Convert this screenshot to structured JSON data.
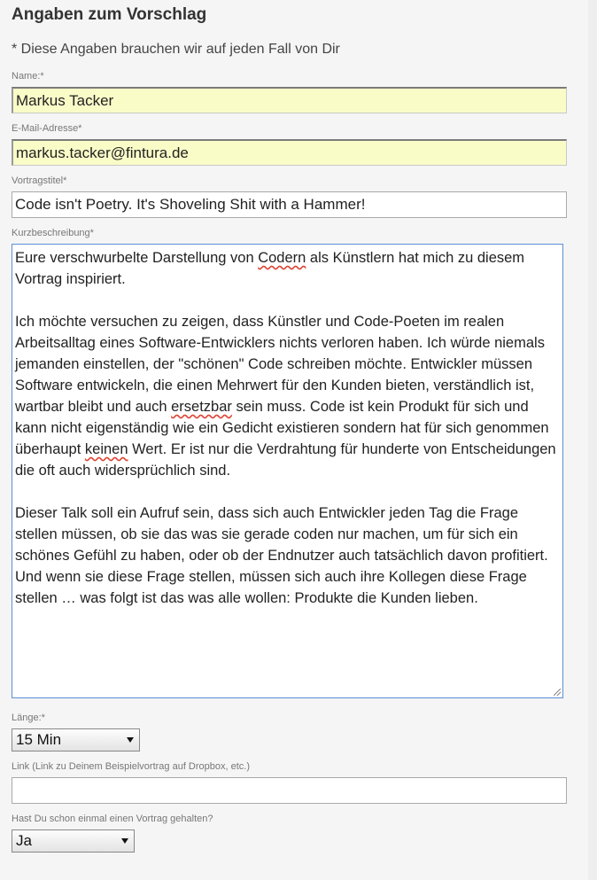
{
  "section": {
    "title": "Angaben zum Vorschlag",
    "required_note": "* Diese Angaben brauchen wir auf jeden Fall von Dir"
  },
  "fields": {
    "name": {
      "label": "Name:*",
      "value": "Markus Tacker"
    },
    "email": {
      "label": "E-Mail-Adresse*",
      "value": "markus.tacker@fintura.de"
    },
    "talk_title": {
      "label": "Vortragstitel*",
      "value": "Code isn't Poetry. It's Shoveling Shit with a Hammer!"
    },
    "summary": {
      "label": "Kurzbeschreibung*",
      "p1a": "Eure verschwurbelte Darstellung von ",
      "p1_misspelled": "Codern",
      "p1b": " als Künstlern hat mich zu diesem Vortrag inspiriert.",
      "p2a": "Ich möchte versuchen zu zeigen, dass Künstler und Code-Poeten im realen Arbeitsalltag eines Software-Entwicklers nichts verloren haben. Ich würde niemals jemanden einstellen, der \"schönen\" Code schreiben möchte. Entwickler müssen Software entwickeln, die einen Mehrwert für den Kunden bieten, verständlich ist, wartbar bleibt und auch ",
      "p2_misspelled1": "ersetzbar",
      "p2b": " sein muss. Code ist kein Produkt für sich und kann nicht eigenständig wie ein Gedicht existieren sondern hat für sich genommen überhaupt ",
      "p2_misspelled2": "keinen",
      "p2c": " Wert. Er ist nur die Verdrahtung für hunderte von Entscheidungen die oft auch widersprüchlich sind.",
      "p3": "Dieser Talk soll ein Aufruf sein, dass sich auch Entwickler jeden Tag die Frage stellen müssen, ob sie das was sie gerade coden nur machen, um für sich ein schönes Gefühl zu haben, oder ob der Endnutzer auch tatsächlich davon profitiert. Und wenn sie diese Frage stellen, müssen sich auch ihre Kollegen diese Frage stellen … was folgt ist das was alle wollen: Produkte die Kunden lieben."
    },
    "length": {
      "label": "Länge:*",
      "selected": "15 Min"
    },
    "link": {
      "label": "Link (Link zu Deinem Beispielvortrag auf Dropbox, etc.)",
      "value": ""
    },
    "experience": {
      "label": "Hast Du schon einmal einen Vortrag gehalten?",
      "selected": "Ja"
    }
  }
}
